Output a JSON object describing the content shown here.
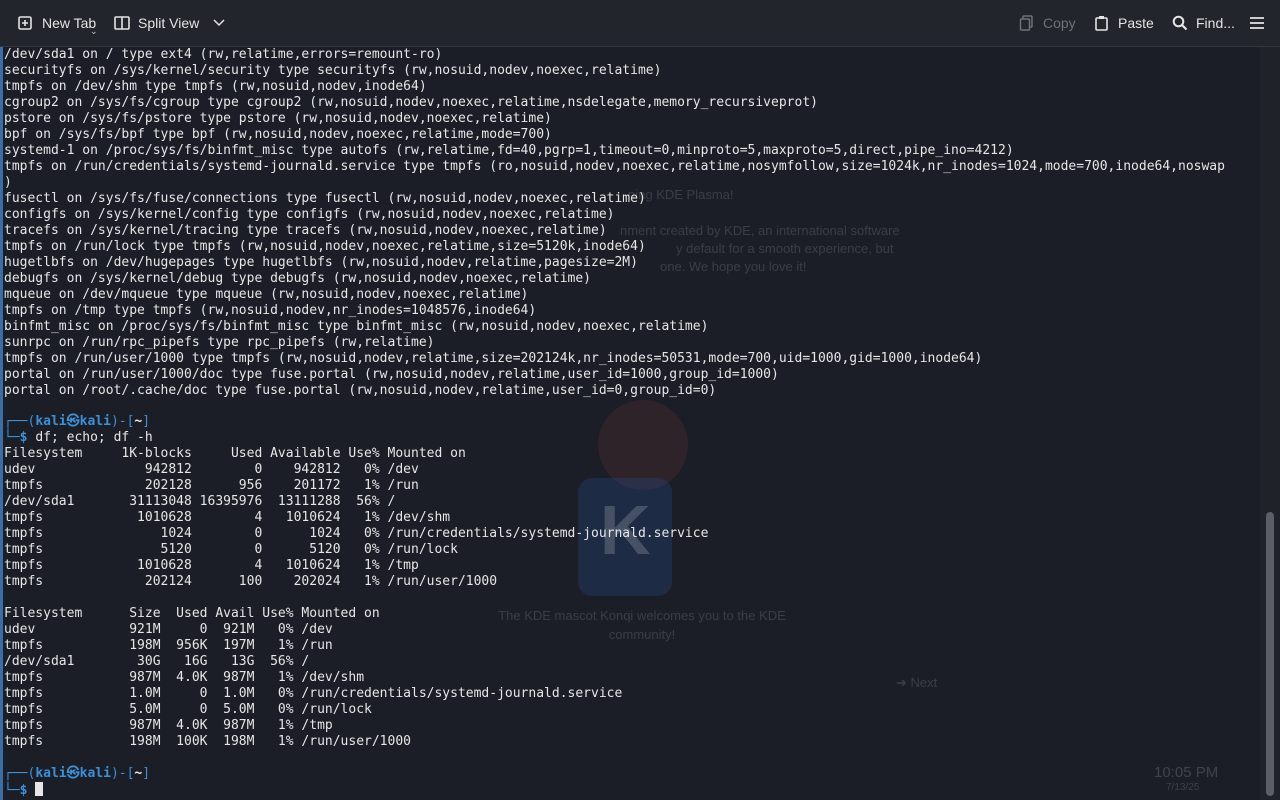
{
  "toolbar": {
    "new_tab": "New Tab",
    "split_view": "Split View",
    "copy": "Copy",
    "paste": "Paste",
    "find": "Find..."
  },
  "terminal": {
    "mount_output": "/dev/sda1 on / type ext4 (rw,relatime,errors=remount-ro)\nsecurityfs on /sys/kernel/security type securityfs (rw,nosuid,nodev,noexec,relatime)\ntmpfs on /dev/shm type tmpfs (rw,nosuid,nodev,inode64)\ncgroup2 on /sys/fs/cgroup type cgroup2 (rw,nosuid,nodev,noexec,relatime,nsdelegate,memory_recursiveprot)\npstore on /sys/fs/pstore type pstore (rw,nosuid,nodev,noexec,relatime)\nbpf on /sys/fs/bpf type bpf (rw,nosuid,nodev,noexec,relatime,mode=700)\nsystemd-1 on /proc/sys/fs/binfmt_misc type autofs (rw,relatime,fd=40,pgrp=1,timeout=0,minproto=5,maxproto=5,direct,pipe_ino=4212)\ntmpfs on /run/credentials/systemd-journald.service type tmpfs (ro,nosuid,nodev,noexec,relatime,nosymfollow,size=1024k,nr_inodes=1024,mode=700,inode64,noswap\n)\nfusectl on /sys/fs/fuse/connections type fusectl (rw,nosuid,nodev,noexec,relatime)\nconfigfs on /sys/kernel/config type configfs (rw,nosuid,nodev,noexec,relatime)\ntracefs on /sys/kernel/tracing type tracefs (rw,nosuid,nodev,noexec,relatime)\ntmpfs on /run/lock type tmpfs (rw,nosuid,nodev,noexec,relatime,size=5120k,inode64)\nhugetlbfs on /dev/hugepages type hugetlbfs (rw,nosuid,nodev,relatime,pagesize=2M)\ndebugfs on /sys/kernel/debug type debugfs (rw,nosuid,nodev,noexec,relatime)\nmqueue on /dev/mqueue type mqueue (rw,nosuid,nodev,noexec,relatime)\ntmpfs on /tmp type tmpfs (rw,nosuid,nodev,nr_inodes=1048576,inode64)\nbinfmt_misc on /proc/sys/fs/binfmt_misc type binfmt_misc (rw,nosuid,nodev,noexec,relatime)\nsunrpc on /run/rpc_pipefs type rpc_pipefs (rw,relatime)\ntmpfs on /run/user/1000 type tmpfs (rw,nosuid,nodev,relatime,size=202124k,nr_inodes=50531,mode=700,uid=1000,gid=1000,inode64)\nportal on /run/user/1000/doc type fuse.portal (rw,nosuid,nodev,relatime,user_id=1000,group_id=1000)\nportal on /root/.cache/doc type fuse.portal (rw,nosuid,nodev,relatime,user_id=0,group_id=0)",
    "prompt": {
      "corner_top": "┌──(",
      "user": "kali㉿kali",
      "mid": ")-[",
      "dir": "~",
      "end": "]",
      "corner_bottom": "└─",
      "dollar": "$ "
    },
    "command": "df; echo; df -h",
    "df_output": "Filesystem     1K-blocks     Used Available Use% Mounted on\nudev              942812        0    942812   0% /dev\ntmpfs             202128      956    201172   1% /run\n/dev/sda1       31113048 16395976  13111288  56% /\ntmpfs            1010628        4   1010624   1% /dev/shm\ntmpfs               1024        0      1024   0% /run/credentials/systemd-journald.service\ntmpfs               5120        0      5120   0% /run/lock\ntmpfs            1010628        4   1010624   1% /tmp\ntmpfs             202124      100    202024   1% /run/user/1000\n\nFilesystem      Size  Used Avail Use% Mounted on\nudev            921M     0  921M   0% /dev\ntmpfs           198M  956K  197M   1% /run\n/dev/sda1        30G   16G   13G  56% /\ntmpfs           987M  4.0K  987M   1% /dev/shm\ntmpfs           1.0M     0  1.0M   0% /run/credentials/systemd-journald.service\ntmpfs           5.0M     0  5.0M   0% /run/lock\ntmpfs           987M  4.0K  987M   1% /tmp\ntmpfs           198M  100K  198M   1% /run/user/1000"
  },
  "background": {
    "welcome_line1": "ning KDE Plasma!",
    "welcome_line2": "nment created by KDE, an international software",
    "welcome_line3": "y default for a smooth experience, but",
    "welcome_line4": "one. We hope you love it!",
    "mascot_caption": "The KDE mascot Konqi welcomes you to the KDE community!",
    "next": "Next",
    "clock": "10:05 PM",
    "date": "7/13/25"
  },
  "colors": {
    "background": "#1b1e26",
    "toolbar": "#22252c",
    "prompt_blue": "#3d8fd6",
    "text": "#e6e6e6",
    "disabled": "#6e7178"
  }
}
